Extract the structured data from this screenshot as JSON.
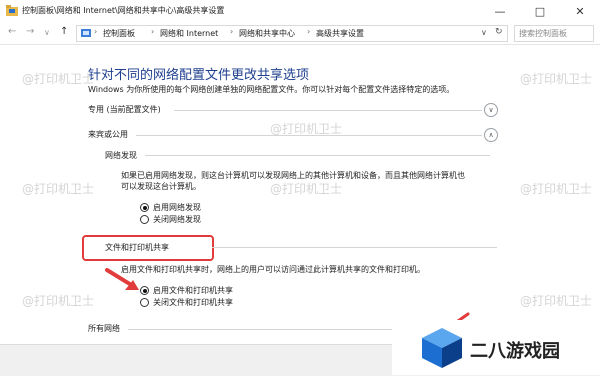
{
  "window": {
    "title": "控制面板\\网络和 Internet\\网络和共享中心\\高级共享设置",
    "minimize": "—",
    "maximize": "□",
    "close": "✕"
  },
  "nav": {
    "back": "←",
    "forward": "→",
    "recent": "∨",
    "up": "↑",
    "breadcrumbs": [
      "控制面板",
      "网络和 Internet",
      "网络和共享中心",
      "高级共享设置"
    ],
    "search_placeholder": "搜索控制面板"
  },
  "main": {
    "heading": "针对不同的网络配置文件更改共享选项",
    "description": "Windows 为你所使用的每个网络创建单独的网络配置文件。你可以针对每个配置文件选择特定的选项。",
    "sections": {
      "private": {
        "label": "专用 (当前配置文件)"
      },
      "guest": {
        "label": "来宾或公用"
      },
      "all": {
        "label": "所有网络"
      }
    },
    "discovery": {
      "title": "网络发现",
      "text_line1": "如果已启用网络发现，则这台计算机可以发现网络上的其他计算机和设备，而且其他网络计算机也",
      "text_line2": "可以发现这台计算机。",
      "option_on": "启用网络发现",
      "option_off": "关闭网络发现"
    },
    "file_sharing": {
      "title": "文件和打印机共享",
      "text": "启用文件和打印机共享时，网络上的用户可以访问通过此计算机共享的文件和打印机。",
      "option_on": "启用文件和打印机共享",
      "option_off": "关闭文件和打印机共享"
    }
  },
  "watermark": "@打印机卫士",
  "logo": {
    "text": "二八游戏园"
  },
  "colors": {
    "heading": "#1e3f8f",
    "highlight": "#e23b3b",
    "logo_blue": "#1c6fd1"
  }
}
